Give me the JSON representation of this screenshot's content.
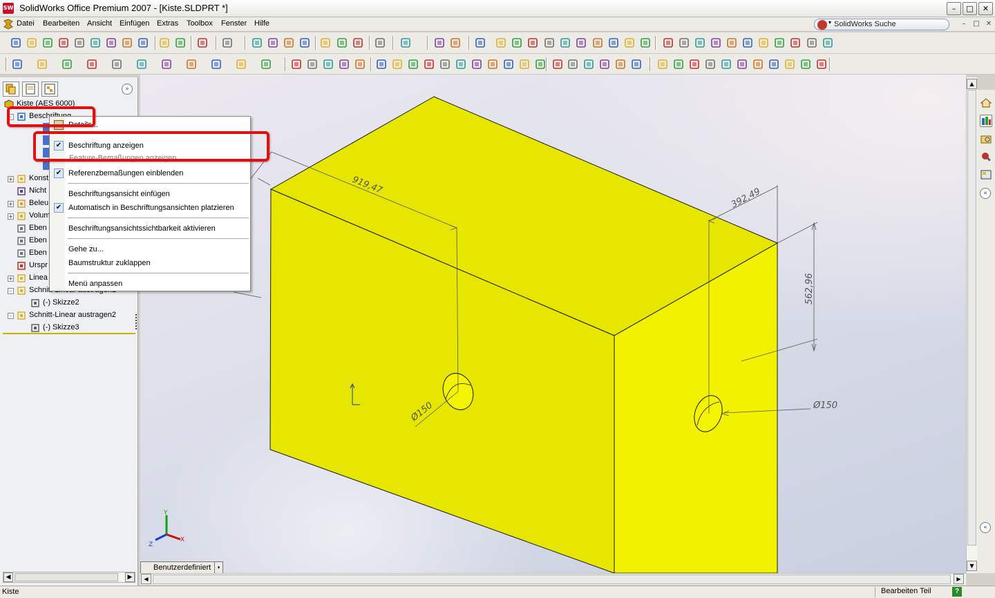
{
  "window": {
    "title": "SolidWorks Office Premium 2007 - [Kiste.SLDPRT *]",
    "app_icon": "SW",
    "minimize": "–",
    "maximize": "□",
    "close": "✕"
  },
  "menubar": {
    "items": [
      "Datei",
      "Bearbeiten",
      "Ansicht",
      "Einfügen",
      "Extras",
      "Toolbox",
      "Fenster",
      "Hilfe"
    ],
    "search": "SolidWorks Suche",
    "mdi_min": "–",
    "mdi_max": "□",
    "mdi_close": "✕"
  },
  "tree": {
    "root": "Kiste  (AES 6000)",
    "items": [
      {
        "label": "Beschriftung",
        "expander": "-"
      },
      {
        "label": "Konst",
        "expander": "+"
      },
      {
        "label": "Nicht",
        "expander": ""
      },
      {
        "label": "Beleu",
        "expander": "+"
      },
      {
        "label": "Volum",
        "expander": "+"
      },
      {
        "label": "Eben",
        "expander": ""
      },
      {
        "label": "Eben",
        "expander": ""
      },
      {
        "label": "Eben",
        "expander": ""
      },
      {
        "label": "Urspr",
        "expander": ""
      },
      {
        "label": "Linea",
        "expander": "+"
      },
      {
        "label": "Schnitt-Linear austragen1",
        "expander": "-"
      },
      {
        "label": "(-) Skizze2",
        "expander": ""
      },
      {
        "label": "Schnitt-Linear austragen2",
        "expander": "-"
      },
      {
        "label": "(-) Skizze3",
        "expander": ""
      }
    ],
    "collapse": "»"
  },
  "context_menu": {
    "details": "Details...",
    "ghost_overlap": "Feature-Bemaßungen anzeigen",
    "items": [
      {
        "label": "Beschriftung anzeigen",
        "checked": true
      },
      {
        "label": "Referenzbemaßungen einblenden",
        "checked": true
      },
      {
        "label": "Beschriftungsansicht einfügen",
        "checked": false
      },
      {
        "label": "Automatisch in Beschriftungsansichten platzieren",
        "checked": true
      },
      {
        "label": "Beschriftungsansichtssichtbarkeit aktivieren",
        "checked": false
      },
      {
        "label": "Gehe zu...",
        "checked": false
      },
      {
        "label": "Baumstruktur zuklappen",
        "checked": false
      },
      {
        "label": "Menü anpassen",
        "checked": false
      }
    ],
    "check_glyph": "✔"
  },
  "viewport": {
    "dimensions": {
      "width": "919,47",
      "depth": "392,49",
      "height": "562,96",
      "hole_front": "Ø150",
      "hole_side": "Ø150"
    },
    "triad": {
      "x": "X",
      "y": "Y",
      "z": "Z"
    },
    "view_tab": "Benutzerdefiniert",
    "view_tab_dd": "▾",
    "part_color": "#e6e600",
    "part_color_side": "#f2f200"
  },
  "statusbar": {
    "left": "Kiste",
    "right": "Bearbeiten Teil",
    "help": "?"
  },
  "scroll": {
    "up": "▲",
    "down": "▼",
    "left": "◀",
    "right": "▶"
  },
  "taskpane": {
    "collapse_top": "«",
    "collapse_bottom": "«"
  }
}
